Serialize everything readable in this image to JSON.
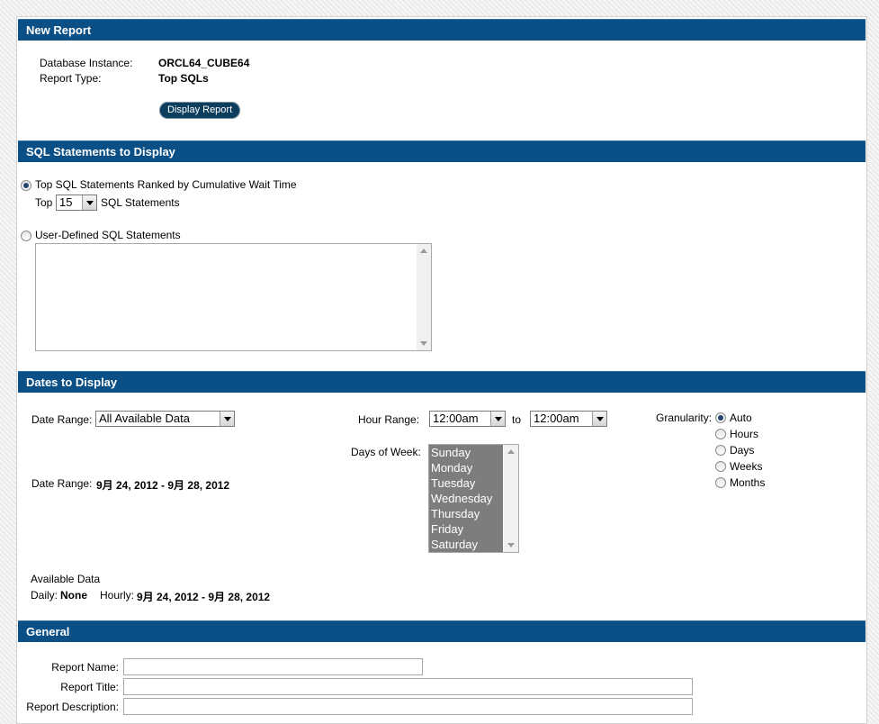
{
  "sections": {
    "new_report": "New Report",
    "sql_statements": "SQL Statements to Display",
    "dates": "Dates to Display",
    "general": "General"
  },
  "new_report": {
    "db_instance_label": "Database Instance:",
    "db_instance_value": "ORCL64_CUBE64",
    "report_type_label": "Report Type:",
    "report_type_value": "Top SQLs",
    "display_button": "Display Report"
  },
  "sql": {
    "option_top_label": "Top SQL Statements Ranked by Cumulative Wait Time",
    "option_top_selected": true,
    "top_prefix": "Top",
    "top_count": "15",
    "top_suffix": "SQL Statements",
    "option_user_label": "User-Defined SQL Statements",
    "option_user_selected": false,
    "user_sql_text": ""
  },
  "dates": {
    "date_range_label": "Date Range:",
    "date_range_value": "All Available Data",
    "date_range_summary_label": "Date Range:",
    "date_range_summary_value": "9月 24, 2012 - 9月 28, 2012",
    "hour_range_label": "Hour Range:",
    "hour_from": "12:00am",
    "hour_to_label": "to",
    "hour_to": "12:00am",
    "days_label": "Days of Week:",
    "days": [
      "Sunday",
      "Monday",
      "Tuesday",
      "Wednesday",
      "Thursday",
      "Friday",
      "Saturday"
    ],
    "granularity_label": "Granularity:",
    "granularity_options": [
      "Auto",
      "Hours",
      "Days",
      "Weeks",
      "Months"
    ],
    "granularity_selected": "Auto",
    "available_title": "Available Data",
    "daily_label": "Daily:",
    "daily_value": "None",
    "hourly_label": "Hourly:",
    "hourly_value": "9月 24, 2012 - 9月 28, 2012"
  },
  "general": {
    "report_name_label": "Report Name:",
    "report_name_value": "",
    "report_title_label": "Report Title:",
    "report_title_value": "",
    "report_description_label": "Report Description:",
    "report_description_value": ""
  }
}
